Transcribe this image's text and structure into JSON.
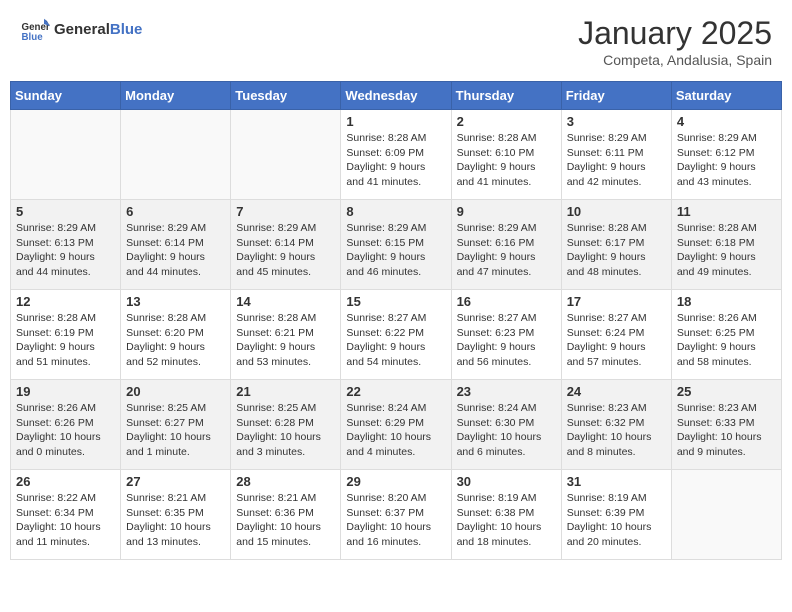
{
  "header": {
    "logo_general": "General",
    "logo_blue": "Blue",
    "month_title": "January 2025",
    "subtitle": "Competa, Andalusia, Spain"
  },
  "weekdays": [
    "Sunday",
    "Monday",
    "Tuesday",
    "Wednesday",
    "Thursday",
    "Friday",
    "Saturday"
  ],
  "weeks": [
    [
      {
        "day": "",
        "info": ""
      },
      {
        "day": "",
        "info": ""
      },
      {
        "day": "",
        "info": ""
      },
      {
        "day": "1",
        "info": "Sunrise: 8:28 AM\nSunset: 6:09 PM\nDaylight: 9 hours\nand 41 minutes."
      },
      {
        "day": "2",
        "info": "Sunrise: 8:28 AM\nSunset: 6:10 PM\nDaylight: 9 hours\nand 41 minutes."
      },
      {
        "day": "3",
        "info": "Sunrise: 8:29 AM\nSunset: 6:11 PM\nDaylight: 9 hours\nand 42 minutes."
      },
      {
        "day": "4",
        "info": "Sunrise: 8:29 AM\nSunset: 6:12 PM\nDaylight: 9 hours\nand 43 minutes."
      }
    ],
    [
      {
        "day": "5",
        "info": "Sunrise: 8:29 AM\nSunset: 6:13 PM\nDaylight: 9 hours\nand 44 minutes."
      },
      {
        "day": "6",
        "info": "Sunrise: 8:29 AM\nSunset: 6:14 PM\nDaylight: 9 hours\nand 44 minutes."
      },
      {
        "day": "7",
        "info": "Sunrise: 8:29 AM\nSunset: 6:14 PM\nDaylight: 9 hours\nand 45 minutes."
      },
      {
        "day": "8",
        "info": "Sunrise: 8:29 AM\nSunset: 6:15 PM\nDaylight: 9 hours\nand 46 minutes."
      },
      {
        "day": "9",
        "info": "Sunrise: 8:29 AM\nSunset: 6:16 PM\nDaylight: 9 hours\nand 47 minutes."
      },
      {
        "day": "10",
        "info": "Sunrise: 8:28 AM\nSunset: 6:17 PM\nDaylight: 9 hours\nand 48 minutes."
      },
      {
        "day": "11",
        "info": "Sunrise: 8:28 AM\nSunset: 6:18 PM\nDaylight: 9 hours\nand 49 minutes."
      }
    ],
    [
      {
        "day": "12",
        "info": "Sunrise: 8:28 AM\nSunset: 6:19 PM\nDaylight: 9 hours\nand 51 minutes."
      },
      {
        "day": "13",
        "info": "Sunrise: 8:28 AM\nSunset: 6:20 PM\nDaylight: 9 hours\nand 52 minutes."
      },
      {
        "day": "14",
        "info": "Sunrise: 8:28 AM\nSunset: 6:21 PM\nDaylight: 9 hours\nand 53 minutes."
      },
      {
        "day": "15",
        "info": "Sunrise: 8:27 AM\nSunset: 6:22 PM\nDaylight: 9 hours\nand 54 minutes."
      },
      {
        "day": "16",
        "info": "Sunrise: 8:27 AM\nSunset: 6:23 PM\nDaylight: 9 hours\nand 56 minutes."
      },
      {
        "day": "17",
        "info": "Sunrise: 8:27 AM\nSunset: 6:24 PM\nDaylight: 9 hours\nand 57 minutes."
      },
      {
        "day": "18",
        "info": "Sunrise: 8:26 AM\nSunset: 6:25 PM\nDaylight: 9 hours\nand 58 minutes."
      }
    ],
    [
      {
        "day": "19",
        "info": "Sunrise: 8:26 AM\nSunset: 6:26 PM\nDaylight: 10 hours\nand 0 minutes."
      },
      {
        "day": "20",
        "info": "Sunrise: 8:25 AM\nSunset: 6:27 PM\nDaylight: 10 hours\nand 1 minute."
      },
      {
        "day": "21",
        "info": "Sunrise: 8:25 AM\nSunset: 6:28 PM\nDaylight: 10 hours\nand 3 minutes."
      },
      {
        "day": "22",
        "info": "Sunrise: 8:24 AM\nSunset: 6:29 PM\nDaylight: 10 hours\nand 4 minutes."
      },
      {
        "day": "23",
        "info": "Sunrise: 8:24 AM\nSunset: 6:30 PM\nDaylight: 10 hours\nand 6 minutes."
      },
      {
        "day": "24",
        "info": "Sunrise: 8:23 AM\nSunset: 6:32 PM\nDaylight: 10 hours\nand 8 minutes."
      },
      {
        "day": "25",
        "info": "Sunrise: 8:23 AM\nSunset: 6:33 PM\nDaylight: 10 hours\nand 9 minutes."
      }
    ],
    [
      {
        "day": "26",
        "info": "Sunrise: 8:22 AM\nSunset: 6:34 PM\nDaylight: 10 hours\nand 11 minutes."
      },
      {
        "day": "27",
        "info": "Sunrise: 8:21 AM\nSunset: 6:35 PM\nDaylight: 10 hours\nand 13 minutes."
      },
      {
        "day": "28",
        "info": "Sunrise: 8:21 AM\nSunset: 6:36 PM\nDaylight: 10 hours\nand 15 minutes."
      },
      {
        "day": "29",
        "info": "Sunrise: 8:20 AM\nSunset: 6:37 PM\nDaylight: 10 hours\nand 16 minutes."
      },
      {
        "day": "30",
        "info": "Sunrise: 8:19 AM\nSunset: 6:38 PM\nDaylight: 10 hours\nand 18 minutes."
      },
      {
        "day": "31",
        "info": "Sunrise: 8:19 AM\nSunset: 6:39 PM\nDaylight: 10 hours\nand 20 minutes."
      },
      {
        "day": "",
        "info": ""
      }
    ]
  ]
}
